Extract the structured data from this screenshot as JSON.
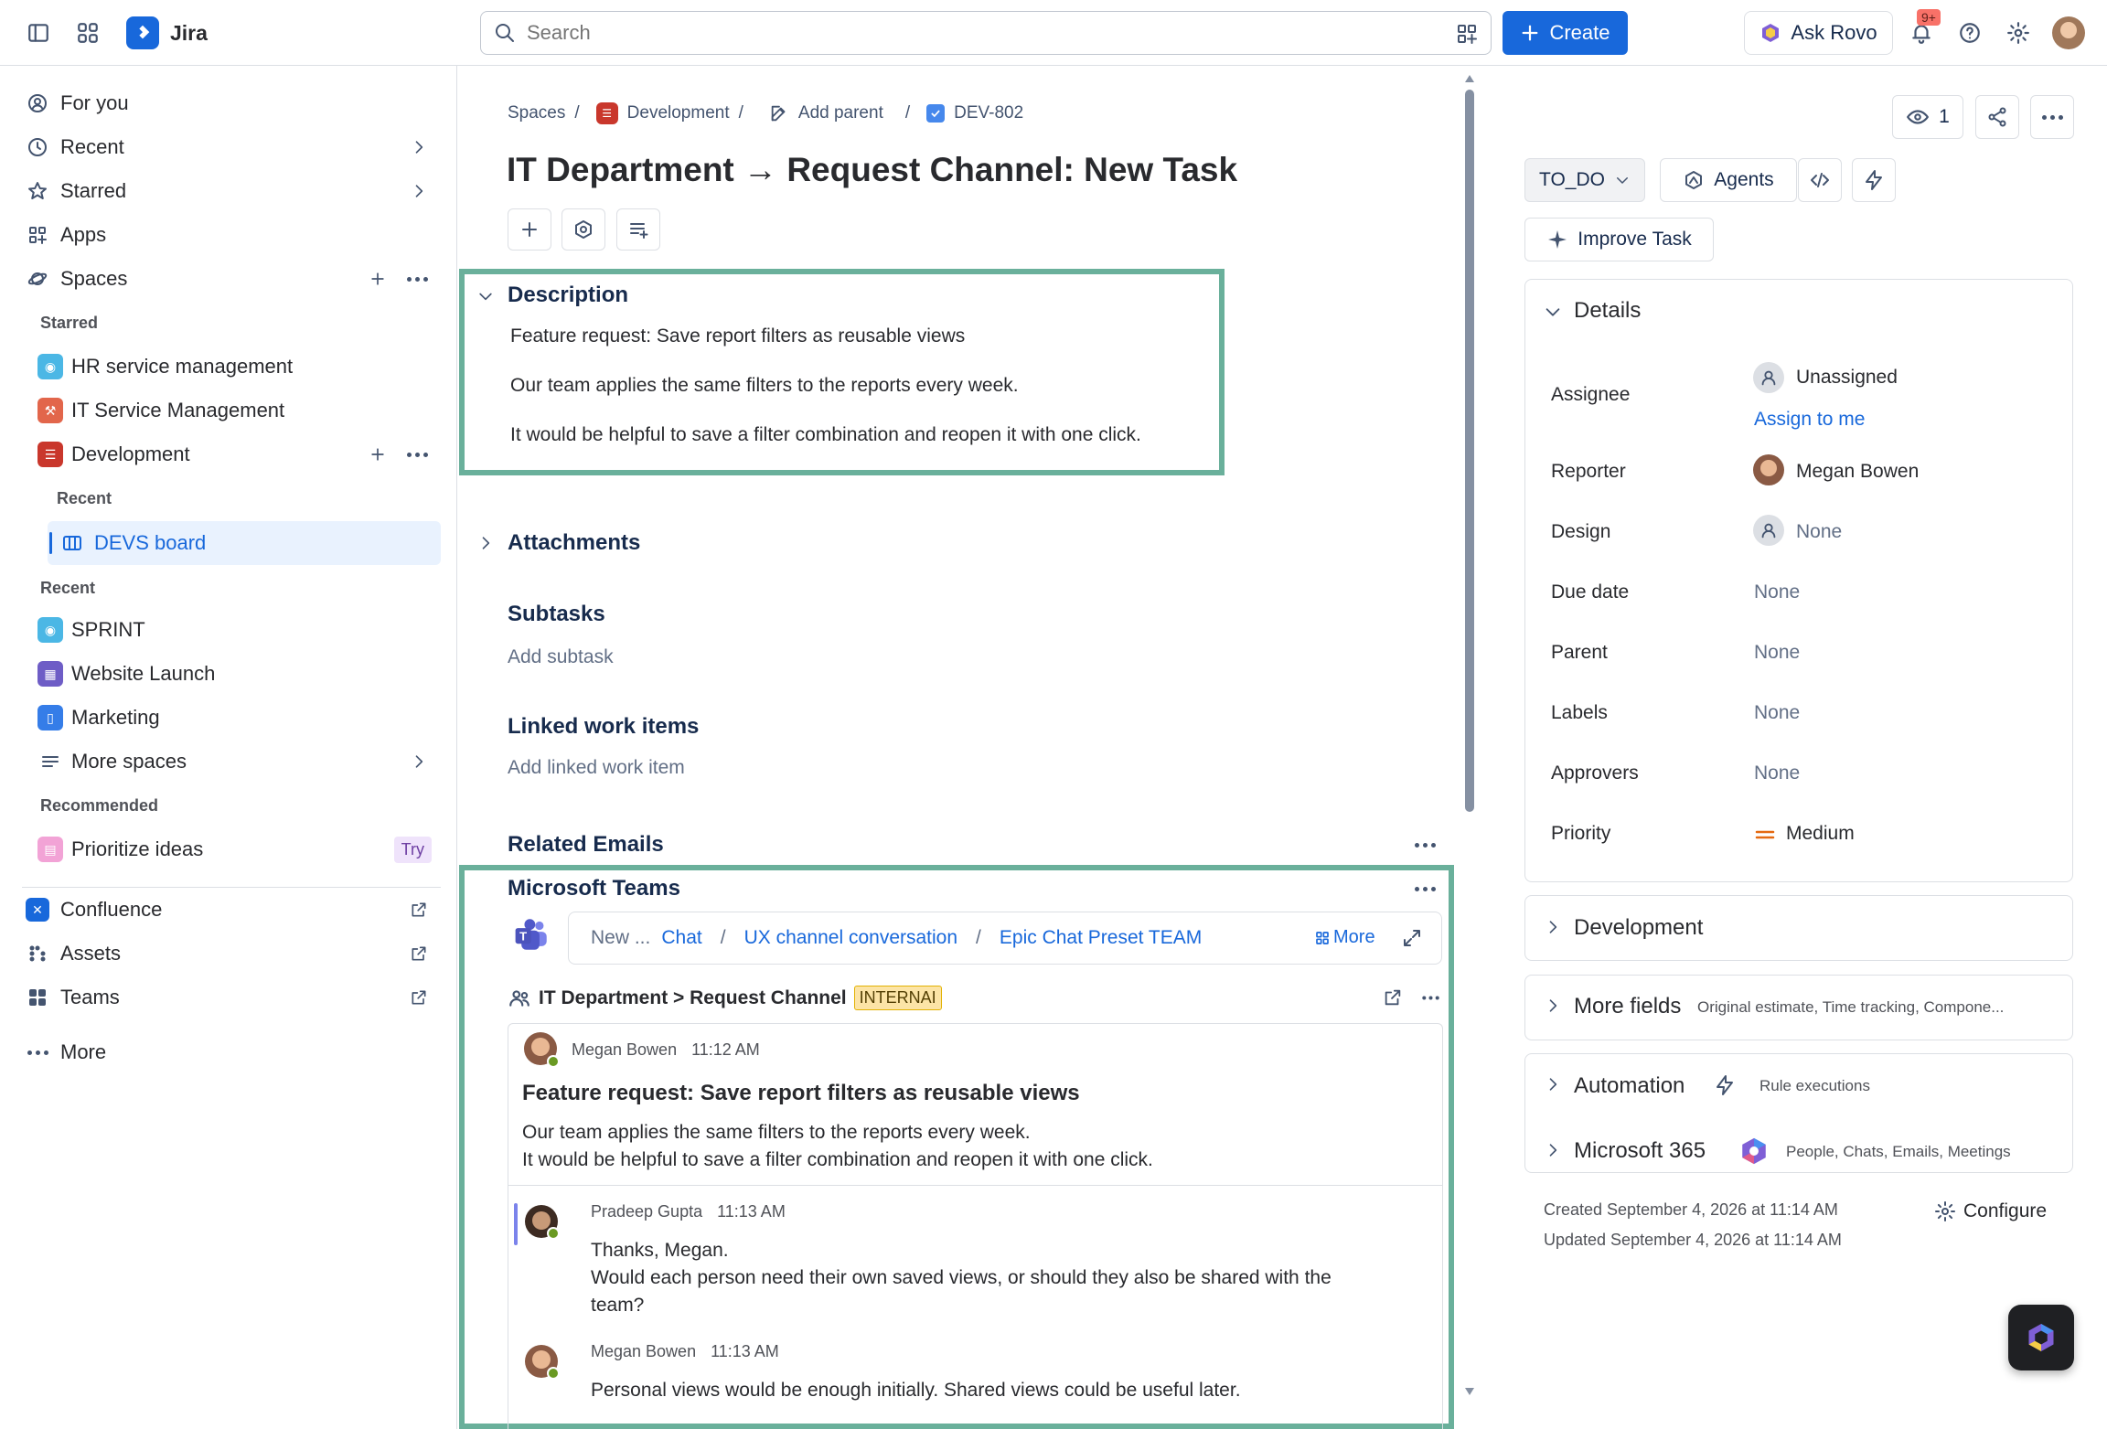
{
  "app": {
    "name": "Jira",
    "brand_color": "#1868db"
  },
  "topbar": {
    "search_placeholder": "Search",
    "create_label": "Create",
    "ask_rovo_label": "Ask Rovo",
    "notification_badge": "9+"
  },
  "sidebar": {
    "items": {
      "for_you": "For you",
      "recent": "Recent",
      "starred": "Starred",
      "apps": "Apps",
      "spaces": "Spaces"
    },
    "starred_label": "Starred",
    "starred_spaces": [
      "HR service management",
      "IT Service Management",
      "Development"
    ],
    "dev_recent_label": "Recent",
    "devs_board": "DEVS board",
    "recent_label": "Recent",
    "recent_spaces": [
      "SPRINT",
      "Website Launch",
      "Marketing"
    ],
    "more_spaces": "More spaces",
    "recommended_label": "Recommended",
    "prioritize_ideas": "Prioritize ideas",
    "try_badge": "Try",
    "apps_links": [
      "Confluence",
      "Assets",
      "Teams"
    ],
    "more": "More"
  },
  "breadcrumb": {
    "spaces": "Spaces",
    "development": "Development",
    "add_parent": "Add parent",
    "issue_key": "DEV-802"
  },
  "issue": {
    "title": "IT Department → Request Channel: New Task",
    "description_heading": "Description",
    "description_lines": [
      "Feature request: Save report filters as reusable views",
      "Our team applies the same filters to the reports every week.",
      "It would be helpful to save a filter combination and reopen it with one click."
    ],
    "attachments": "Attachments",
    "subtasks": "Subtasks",
    "add_subtask": "Add subtask",
    "linked_items": "Linked work items",
    "add_linked_item": "Add linked work item",
    "related_emails": "Related Emails"
  },
  "teams": {
    "heading": "Microsoft Teams",
    "path_new": "New ...",
    "path_chat": "Chat",
    "path_channel": "UX channel conversation",
    "path_preset": "Epic Chat Preset TEAM",
    "more_label": "More",
    "channel_name": "IT Department > Request Channel",
    "channel_badge": "INTERNAI",
    "post": {
      "author": "Megan Bowen",
      "time": "11:12 AM",
      "subject": "Feature request: Save report filters as reusable views",
      "line1": "Our team applies the same filters to the reports every week.",
      "line2": "It would be helpful to save a filter combination and reopen it with one click."
    },
    "reply1": {
      "author": "Pradeep Gupta",
      "time": "11:13 AM",
      "line1": "Thanks, Megan.",
      "line2": "Would each person need their own saved views, or should they also be shared with the",
      "line3": "team?"
    },
    "reply2": {
      "author": "Megan Bowen",
      "time": "11:13 AM",
      "line1": "Personal views would be enough initially. Shared views could be useful later."
    }
  },
  "right": {
    "watchers": "1",
    "status": "TO_DO",
    "agents": "Agents",
    "improve_task": "Improve Task",
    "details_heading": "Details",
    "fields": {
      "assignee_label": "Assignee",
      "assignee_value": "Unassigned",
      "assign_to_me": "Assign to me",
      "reporter_label": "Reporter",
      "reporter_value": "Megan Bowen",
      "design_label": "Design",
      "design_value": "None",
      "due_label": "Due date",
      "due_value": "None",
      "parent_label": "Parent",
      "parent_value": "None",
      "labels_label": "Labels",
      "labels_value": "None",
      "approvers_label": "Approvers",
      "approvers_value": "None",
      "priority_label": "Priority",
      "priority_value": "Medium"
    },
    "development": "Development",
    "more_fields": "More fields",
    "more_fields_hint": "Original estimate, Time tracking, Compone...",
    "automation": "Automation",
    "rule_executions": "Rule executions",
    "m365": "Microsoft 365",
    "m365_hint": "People, Chats, Emails, Meetings",
    "created": "Created September 4, 2026 at 11:14 AM",
    "updated": "Updated September 4, 2026 at 11:14 AM",
    "configure": "Configure"
  }
}
